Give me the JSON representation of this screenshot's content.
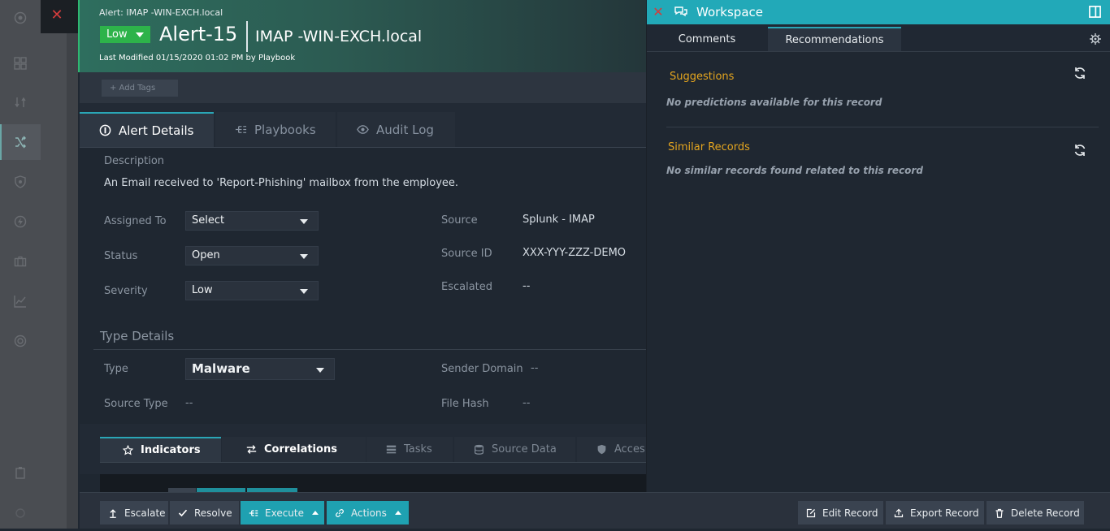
{
  "header": {
    "breadcrumb": "Alert: IMAP -WIN-EXCH.local",
    "severity": "Low",
    "alert_id": "Alert-15",
    "alert_name": "IMAP -WIN-EXCH.local",
    "modified": "Last Modified 01/15/2020 01:02 PM by Playbook",
    "add_tags": "+ Add Tags"
  },
  "tabs": [
    {
      "label": "Alert Details",
      "icon": "info-icon"
    },
    {
      "label": "Playbooks",
      "icon": "playbook-icon"
    },
    {
      "label": "Audit Log",
      "icon": "eye-icon"
    }
  ],
  "details": {
    "description_label": "Description",
    "description": "An Email received to 'Report-Phishing' mailbox from the employee.",
    "assigned_label": "Assigned To",
    "assigned_value": "Select",
    "status_label": "Status",
    "status_value": "Open",
    "severity_label": "Severity",
    "severity_value": "Low",
    "source_label": "Source",
    "source_value": "Splunk - IMAP",
    "source_id_label": "Source ID",
    "source_id_value": "XXX-YYY-ZZZ-DEMO",
    "escalated_label": "Escalated",
    "escalated_value": "--"
  },
  "type_details": {
    "heading": "Type Details",
    "type_label": "Type",
    "type_value": "Malware",
    "source_type_label": "Source Type",
    "source_type_value": "--",
    "sender_domain_label": "Sender Domain",
    "sender_domain_value": "--",
    "file_hash_label": "File Hash",
    "file_hash_value": "--"
  },
  "sub_tabs": [
    {
      "label": "Indicators",
      "icon": "star-icon"
    },
    {
      "label": "Correlations",
      "icon": "arrows-icon"
    },
    {
      "label": "Tasks",
      "icon": "tasks-icon"
    },
    {
      "label": "Source Data",
      "icon": "database-icon"
    },
    {
      "label": "Acces",
      "icon": "shield-icon"
    }
  ],
  "footer": {
    "escalate": "Escalate",
    "resolve": "Resolve",
    "execute": "Execute",
    "actions": "Actions",
    "edit": "Edit Record",
    "export": "Export Record",
    "delete": "Delete Record"
  },
  "workspace": {
    "title": "Workspace",
    "tab_comments": "Comments",
    "tab_recommendations": "Recommendations",
    "suggestions_heading": "Suggestions",
    "suggestions_msg": "No predictions available for this record",
    "similar_heading": "Similar Records",
    "similar_msg": "No similar records found related to this record"
  },
  "colors": {
    "accent": "#22a9b8",
    "severity_low": "#2db34a",
    "section_heading": "#e4a51f"
  }
}
